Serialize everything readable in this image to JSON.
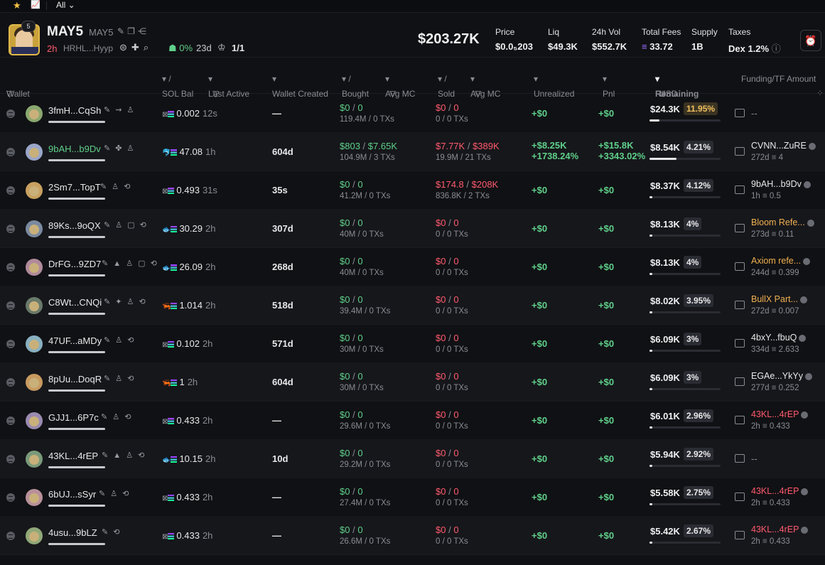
{
  "topbar": {
    "filter": "All"
  },
  "token": {
    "name": "MAY5",
    "ticker": "MAY5",
    "badge": "5",
    "age": "2h",
    "address": "HRHL...Hyyp",
    "top10_pct": "0%",
    "days": "23d",
    "holders": "1/1",
    "market_cap": "$203.27K"
  },
  "stats": [
    {
      "label": "Price",
      "value": "$0.0₅203"
    },
    {
      "label": "Liq",
      "value": "$49.3K"
    },
    {
      "label": "24h Vol",
      "value": "$552.7K"
    },
    {
      "label": "Total Fees",
      "value": "33.72"
    },
    {
      "label": "Supply",
      "value": "1B"
    },
    {
      "label": "Taxes",
      "value": "Dex 1.2%"
    }
  ],
  "columns": {
    "wallet": "Wallet",
    "sol_bal": "SOL Bal",
    "last_active": "Last Active",
    "wallet_created": "Wallet Created",
    "bought": "Bought",
    "avg_mc1": "Avg MC",
    "sold": "Sold",
    "avg_mc2": "Avg MC",
    "unrealized": "Unrealized",
    "pnl": "Pnl",
    "remaining": "Remaining",
    "usd": "USD",
    "funding": "Funding/TF Amount"
  },
  "rows": [
    {
      "wallet": "3fmH...CqSh",
      "green": false,
      "sol": "0.002",
      "last": "12s",
      "created": "—",
      "b_usd": "$0",
      "b_sol": "0",
      "b_sub": "119.4M / 0 TXs",
      "s_usd": "$0",
      "s_sol": "0",
      "s_sub": "0 / 0 TXs",
      "un": "+$0",
      "un2": "",
      "pnl": "+$0",
      "pnl2": "",
      "rem": "$24.3K",
      "rpct": "11.95%",
      "rfrac": 0.14,
      "hi": true,
      "f1": "--",
      "f2": "",
      "ftype": "dash"
    },
    {
      "wallet": "9bAH...b9Dv",
      "green": true,
      "sol": "47.08",
      "last": "1h",
      "created": "604d",
      "b_usd": "$803",
      "b_sol": "$7.65K",
      "b_sub": "104.9M / 3 TXs",
      "s_usd": "$7.77K",
      "s_sol": "$389K",
      "s_sub": "19.9M / 21 TXs",
      "un": "+$8.25K",
      "un2": "+1738.24%",
      "pnl": "+$15.8K",
      "pnl2": "+3343.02%",
      "rem": "$8.54K",
      "rpct": "4.21%",
      "rfrac": 0.38,
      "hi": false,
      "f1": "CVNN...ZuRE",
      "f2": "272d ≡ 4",
      "ftype": "white"
    },
    {
      "wallet": "2Sm7...TopT",
      "green": false,
      "sol": "0.493",
      "last": "31s",
      "created": "35s",
      "b_usd": "$0",
      "b_sol": "0",
      "b_sub": "41.2M / 0 TXs",
      "s_usd": "$174.8",
      "s_sol": "$208K",
      "s_sub": "836.8K / 2 TXs",
      "un": "+$0",
      "un2": "",
      "pnl": "+$0",
      "pnl2": "",
      "rem": "$8.37K",
      "rpct": "4.12%",
      "rfrac": 0.04,
      "hi": false,
      "f1": "9bAH...b9Dv",
      "f2": "1h ≡ 0.5",
      "ftype": "white"
    },
    {
      "wallet": "89Ks...9oQX",
      "green": false,
      "sol": "30.29",
      "last": "2h",
      "created": "307d",
      "b_usd": "$0",
      "b_sol": "0",
      "b_sub": "40M / 0 TXs",
      "s_usd": "$0",
      "s_sol": "0",
      "s_sub": "0 / 0 TXs",
      "un": "+$0",
      "un2": "",
      "pnl": "+$0",
      "pnl2": "",
      "rem": "$8.13K",
      "rpct": "4%",
      "rfrac": 0.04,
      "hi": false,
      "f1": "Bloom Refe...",
      "f2": "273d ≡ 0.11",
      "ftype": "gold"
    },
    {
      "wallet": "DrFG...9ZD7",
      "green": false,
      "sol": "26.09",
      "last": "2h",
      "created": "268d",
      "b_usd": "$0",
      "b_sol": "0",
      "b_sub": "40M / 0 TXs",
      "s_usd": "$0",
      "s_sol": "0",
      "s_sub": "0 / 0 TXs",
      "un": "+$0",
      "un2": "",
      "pnl": "+$0",
      "pnl2": "",
      "rem": "$8.13K",
      "rpct": "4%",
      "rfrac": 0.04,
      "hi": false,
      "f1": "Axiom refe...",
      "f2": "244d ≡ 0.399",
      "ftype": "gold"
    },
    {
      "wallet": "C8Wt...CNQi",
      "green": false,
      "sol": "1.014",
      "last": "2h",
      "created": "518d",
      "b_usd": "$0",
      "b_sol": "0",
      "b_sub": "39.4M / 0 TXs",
      "s_usd": "$0",
      "s_sol": "0",
      "s_sub": "0 / 0 TXs",
      "un": "+$0",
      "un2": "",
      "pnl": "+$0",
      "pnl2": "",
      "rem": "$8.02K",
      "rpct": "3.95%",
      "rfrac": 0.04,
      "hi": false,
      "f1": "BullX Part...",
      "f2": "272d ≡ 0.007",
      "ftype": "gold"
    },
    {
      "wallet": "47UF...aMDy",
      "green": false,
      "sol": "0.102",
      "last": "2h",
      "created": "571d",
      "b_usd": "$0",
      "b_sol": "0",
      "b_sub": "30M / 0 TXs",
      "s_usd": "$0",
      "s_sol": "0",
      "s_sub": "0 / 0 TXs",
      "un": "+$0",
      "un2": "",
      "pnl": "+$0",
      "pnl2": "",
      "rem": "$6.09K",
      "rpct": "3%",
      "rfrac": 0.04,
      "hi": false,
      "f1": "4bxY...fbuQ",
      "f2": "334d ≡ 2.633",
      "ftype": "white"
    },
    {
      "wallet": "8pUu...DoqR",
      "green": false,
      "sol": "1",
      "last": "2h",
      "created": "604d",
      "b_usd": "$0",
      "b_sol": "0",
      "b_sub": "30M / 0 TXs",
      "s_usd": "$0",
      "s_sol": "0",
      "s_sub": "0 / 0 TXs",
      "un": "+$0",
      "un2": "",
      "pnl": "+$0",
      "pnl2": "",
      "rem": "$6.09K",
      "rpct": "3%",
      "rfrac": 0.04,
      "hi": false,
      "f1": "EGAe...YkYy",
      "f2": "277d ≡ 0.252",
      "ftype": "white"
    },
    {
      "wallet": "GJJ1...6P7c",
      "green": false,
      "sol": "0.433",
      "last": "2h",
      "created": "—",
      "b_usd": "$0",
      "b_sol": "0",
      "b_sub": "29.6M / 0 TXs",
      "s_usd": "$0",
      "s_sol": "0",
      "s_sub": "0 / 0 TXs",
      "un": "+$0",
      "un2": "",
      "pnl": "+$0",
      "pnl2": "",
      "rem": "$6.01K",
      "rpct": "2.96%",
      "rfrac": 0.04,
      "hi": false,
      "f1": "43KL...4rEP",
      "f2": "2h ≡ 0.433",
      "ftype": "pink"
    },
    {
      "wallet": "43KL...4rEP",
      "green": false,
      "sol": "10.15",
      "last": "2h",
      "created": "10d",
      "b_usd": "$0",
      "b_sol": "0",
      "b_sub": "29.2M / 0 TXs",
      "s_usd": "$0",
      "s_sol": "0",
      "s_sub": "0 / 0 TXs",
      "un": "+$0",
      "un2": "",
      "pnl": "+$0",
      "pnl2": "",
      "rem": "$5.94K",
      "rpct": "2.92%",
      "rfrac": 0.04,
      "hi": false,
      "f1": "--",
      "f2": "",
      "ftype": "dash"
    },
    {
      "wallet": "6bUJ...sSyr",
      "green": false,
      "sol": "0.433",
      "last": "2h",
      "created": "—",
      "b_usd": "$0",
      "b_sol": "0",
      "b_sub": "27.4M / 0 TXs",
      "s_usd": "$0",
      "s_sol": "0",
      "s_sub": "0 / 0 TXs",
      "un": "+$0",
      "un2": "",
      "pnl": "+$0",
      "pnl2": "",
      "rem": "$5.58K",
      "rpct": "2.75%",
      "rfrac": 0.04,
      "hi": false,
      "f1": "43KL...4rEP",
      "f2": "2h ≡ 0.433",
      "ftype": "pink"
    },
    {
      "wallet": "4usu...9bLZ",
      "green": false,
      "sol": "0.433",
      "last": "2h",
      "created": "—",
      "b_usd": "$0",
      "b_sol": "0",
      "b_sub": "26.6M / 0 TXs",
      "s_usd": "$0",
      "s_sol": "0",
      "s_sub": "0 / 0 TXs",
      "un": "+$0",
      "un2": "",
      "pnl": "+$0",
      "pnl2": "",
      "rem": "$5.42K",
      "rpct": "2.67%",
      "rfrac": 0.04,
      "hi": false,
      "f1": "43KL...4rEP",
      "f2": "2h ≡ 0.433",
      "ftype": "pink"
    }
  ]
}
